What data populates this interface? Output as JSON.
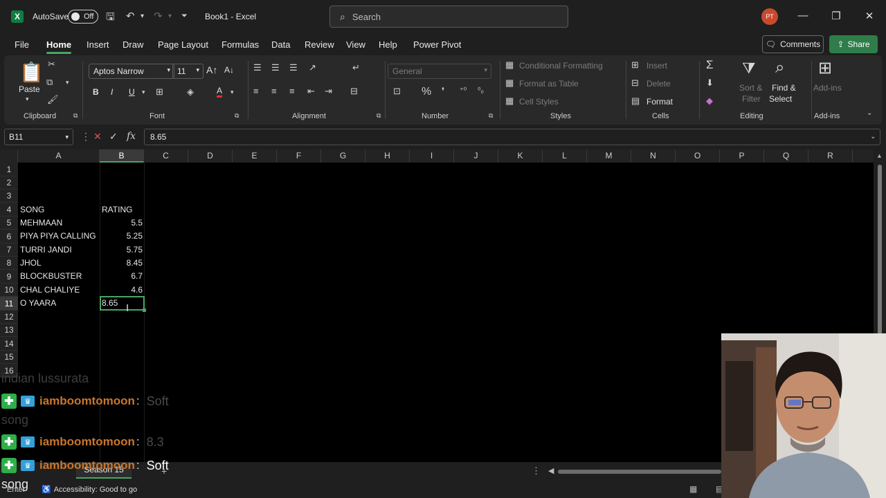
{
  "app": {
    "autosave_label": "AutoSave",
    "autosave_state": "Off",
    "doc_title": "Book1  -  Excel",
    "search_placeholder": "Search",
    "user_initials": "PT"
  },
  "menu": {
    "tabs": [
      "File",
      "Home",
      "Insert",
      "Draw",
      "Page Layout",
      "Formulas",
      "Data",
      "Review",
      "View",
      "Help",
      "Power Pivot"
    ],
    "active_tab": "Home",
    "comments_label": "Comments",
    "share_label": "Share"
  },
  "ribbon": {
    "groups": [
      "Clipboard",
      "Font",
      "Alignment",
      "Number",
      "Styles",
      "Cells",
      "Editing",
      "Add-ins"
    ],
    "paste_label": "Paste",
    "font_name": "Aptos Narrow",
    "font_size": "11",
    "number_format": "General",
    "styles": [
      "Conditional Formatting",
      "Format as Table",
      "Cell Styles"
    ],
    "cells": [
      "Insert",
      "Delete",
      "Format"
    ],
    "editing": [
      "Sort &",
      "Filter",
      "Find &",
      "Select"
    ],
    "addins_label": "Add-ins"
  },
  "formula_bar": {
    "name_box": "B11",
    "formula": "8.65"
  },
  "sheet": {
    "columns": [
      "A",
      "B",
      "C",
      "D",
      "E",
      "F",
      "G",
      "H",
      "I",
      "J",
      "K",
      "L",
      "M",
      "N",
      "O",
      "P",
      "Q",
      "R"
    ],
    "selected_column": "B",
    "rows": [
      "1",
      "2",
      "3",
      "4",
      "5",
      "6",
      "7",
      "8",
      "9",
      "10",
      "11",
      "12",
      "13",
      "14",
      "15",
      "16"
    ],
    "selected_row": "11",
    "header": {
      "song": "SONG",
      "rating": "RATING"
    },
    "data": [
      {
        "song": "MEHMAAN",
        "rating": "5.5"
      },
      {
        "song": "PIYA PIYA CALLING",
        "rating": "5.25"
      },
      {
        "song": "TURRI JANDI",
        "rating": "5.75"
      },
      {
        "song": "JHOL",
        "rating": "8.45"
      },
      {
        "song": "BLOCKBUSTER",
        "rating": "6.7"
      },
      {
        "song": "CHAL CHALIYE",
        "rating": "4.6"
      },
      {
        "song": "O YAARA",
        "rating": "8.65"
      }
    ],
    "tab_name": "Season 15"
  },
  "status": {
    "mode": "Enter",
    "accessibility": "Accessibility: Good to go"
  },
  "chat": {
    "username": "iamboomtomoon",
    "messages": [
      "Soft",
      "8.3",
      "Soft"
    ],
    "fragments": [
      "indian lussurata",
      "song",
      "song"
    ]
  },
  "colors": {
    "accent_green": "#4aa564",
    "share_green": "#2f7d4a",
    "chat_user": "#c9762b",
    "excel_brand": "#107c41"
  }
}
